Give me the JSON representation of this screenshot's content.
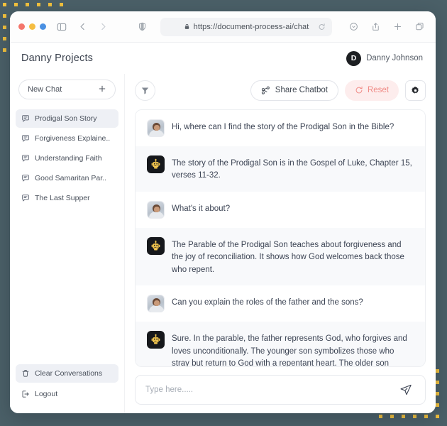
{
  "browser": {
    "url": "https://document-process-ai/chat",
    "traffic_lights": [
      "red",
      "yellow",
      "blue"
    ],
    "icons": {
      "sidebar_toggle": "sidebar-toggle-icon",
      "back": "back-arrow-icon",
      "forward": "forward-arrow-icon",
      "shield": "shield-icon",
      "lock": "lock-icon",
      "reload": "reload-icon",
      "extensions": "extensions-icon",
      "share": "share-upload-icon",
      "new_tab": "plus-icon",
      "tabs": "copy-tabs-icon"
    }
  },
  "header": {
    "brand": "Danny Projects",
    "user": {
      "initial": "D",
      "name": "Danny Johnson"
    }
  },
  "sidebar": {
    "new_chat_label": "New Chat",
    "conversations": [
      {
        "label": "Prodigal Son Story",
        "active": true
      },
      {
        "label": "Forgiveness Explaine..",
        "active": false
      },
      {
        "label": "Understanding Faith",
        "active": false
      },
      {
        "label": "Good Samaritan Par..",
        "active": false
      },
      {
        "label": "The Last Supper",
        "active": false
      }
    ],
    "footer": [
      {
        "label": "Clear Conversations",
        "icon": "trash-icon",
        "shaded": true
      },
      {
        "label": "Logout",
        "icon": "logout-icon",
        "shaded": false
      }
    ]
  },
  "toolbar": {
    "filter_icon": "filter-funnel-icon",
    "share_label": "Share Chatbot",
    "reset_label": "Reset",
    "settings_icon": "gear-icon"
  },
  "chat": {
    "messages": [
      {
        "role": "user",
        "text": "Hi, where can I find the story of the Prodigal Son in the Bible?"
      },
      {
        "role": "bot",
        "text": "The story of the Prodigal Son is in the Gospel of Luke, Chapter 15, verses 11-32."
      },
      {
        "role": "user",
        "text": "What's it about?"
      },
      {
        "role": "bot",
        "text": "The Parable of the Prodigal Son teaches about forgiveness and the joy of reconciliation. It shows how God welcomes back those who repent."
      },
      {
        "role": "user",
        "text": "Can you explain the roles of the father and the sons?"
      },
      {
        "role": "bot",
        "text": "Sure. In the parable, the father represents God, who forgives and loves unconditionally. The younger son symbolizes those who stray but return to God with a repentant heart. The older son represents those who are resentful when others are forgiven."
      }
    ]
  },
  "composer": {
    "placeholder": "Type here.....",
    "value": "",
    "send_icon": "send-paper-plane-icon"
  },
  "colors": {
    "page_background": "#4b6068",
    "dot_accent": "#f3c23d",
    "reset_pill_bg": "#fdeded",
    "reset_text": "#f08a85",
    "bot_row_bg": "#f8f9fb",
    "active_item_bg": "#eef0f5"
  }
}
